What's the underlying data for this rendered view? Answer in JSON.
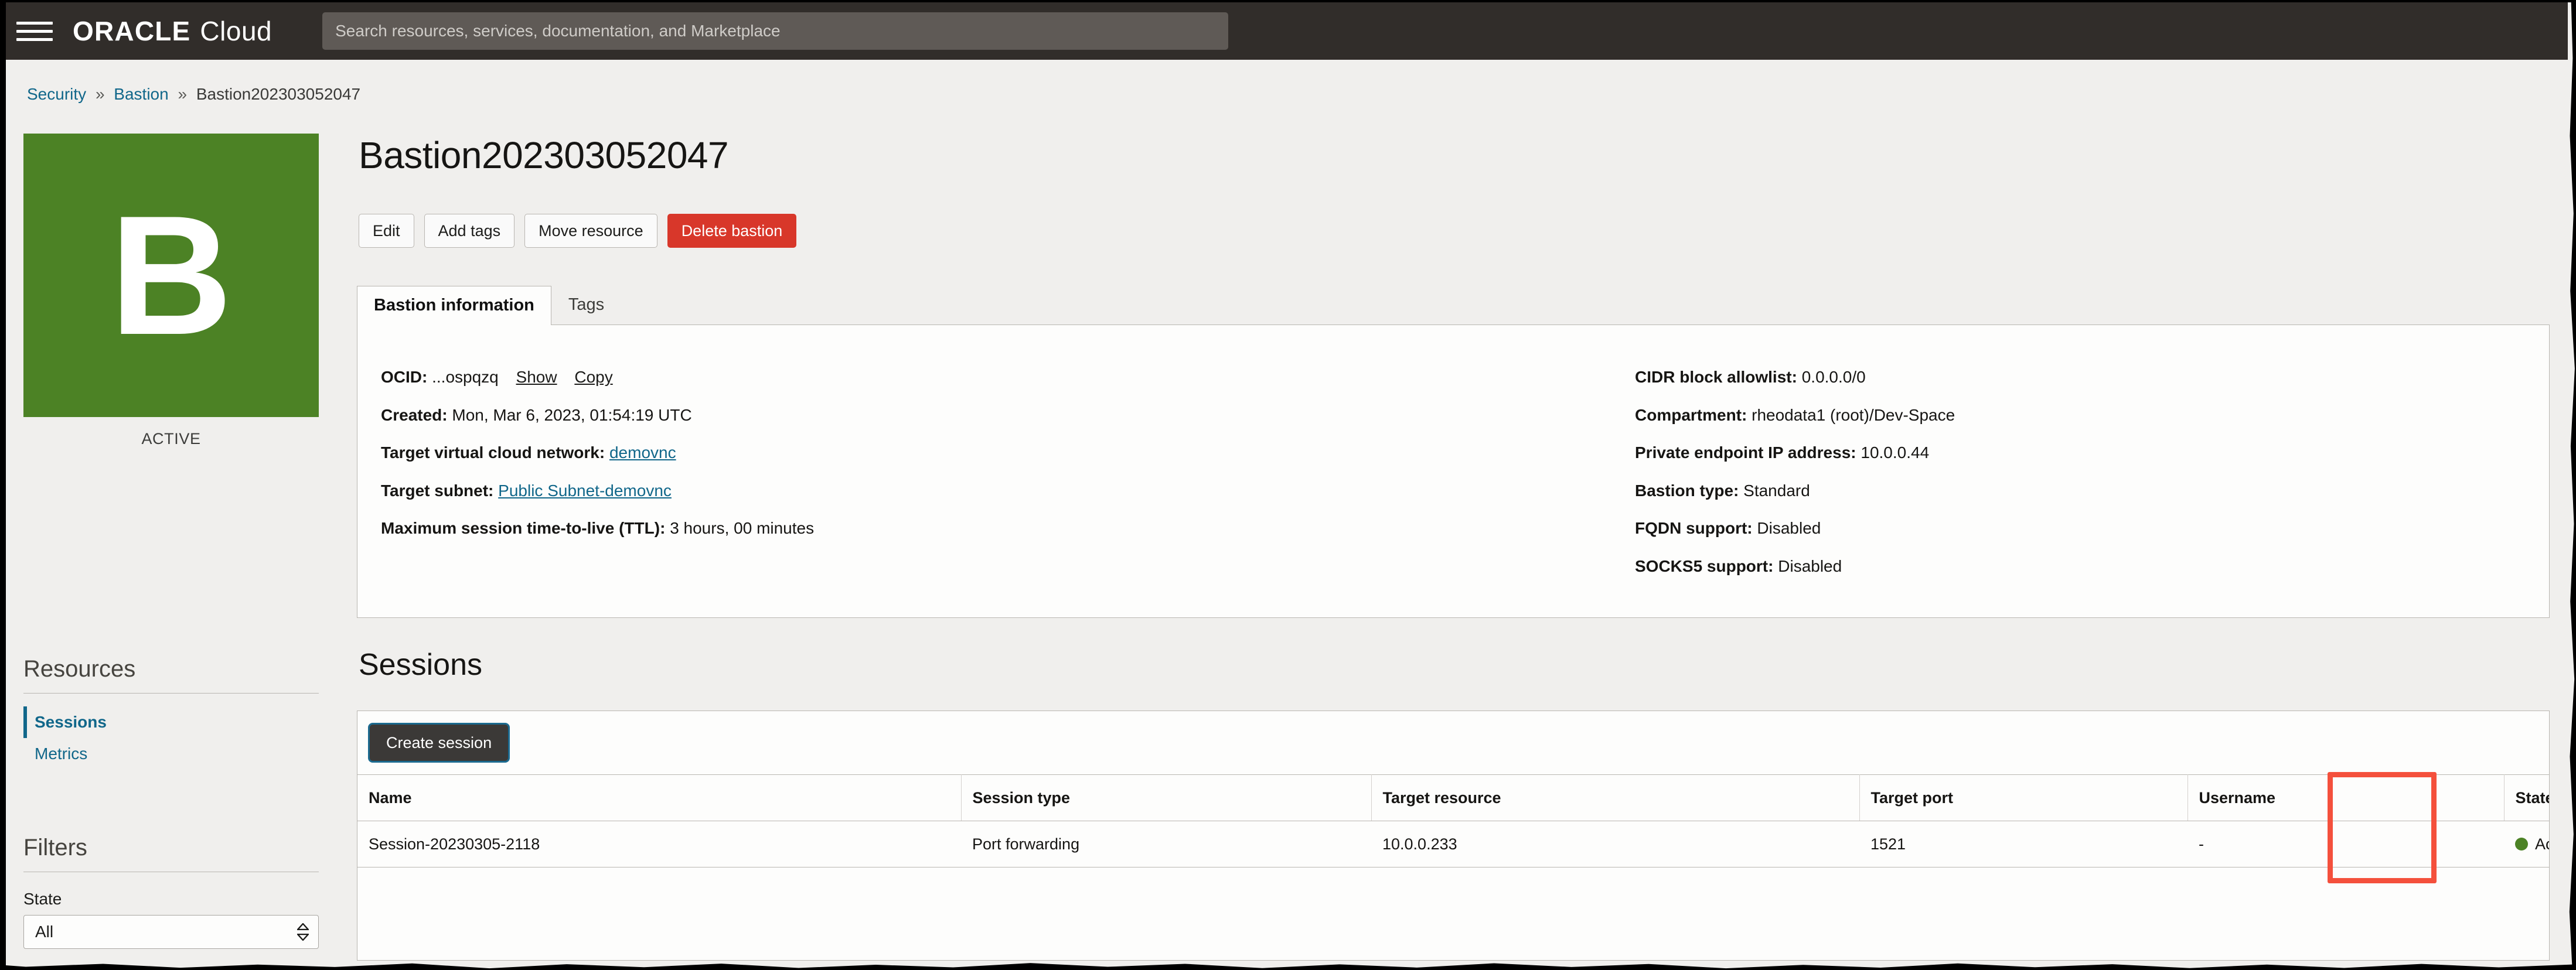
{
  "topnav": {
    "menu_icon": "hamburger-icon",
    "brand_primary": "ORACLE",
    "brand_secondary": "Cloud",
    "search_placeholder": "Search resources, services, documentation, and Marketplace",
    "search_value": ""
  },
  "breadcrumb": {
    "items": [
      {
        "label": "Security",
        "link": true
      },
      {
        "label": "Bastion",
        "link": true
      },
      {
        "label": "Bastion202303052047",
        "link": false
      }
    ],
    "separator": "»"
  },
  "avatar": {
    "letter": "B",
    "status": "ACTIVE",
    "color": "#4c8225"
  },
  "header": {
    "title": "Bastion202303052047",
    "actions": [
      {
        "label": "Edit",
        "style": "default"
      },
      {
        "label": "Add tags",
        "style": "default"
      },
      {
        "label": "Move resource",
        "style": "default"
      },
      {
        "label": "Delete bastion",
        "style": "danger"
      }
    ],
    "danger_color": "#d8372a"
  },
  "tabs": [
    {
      "label": "Bastion information",
      "active": true
    },
    {
      "label": "Tags",
      "active": false
    }
  ],
  "info": {
    "left": [
      {
        "label": "OCID:",
        "value": "...ospqzq",
        "links": [
          "Show",
          "Copy"
        ]
      },
      {
        "label": "Created:",
        "value": "Mon, Mar 6, 2023, 01:54:19 UTC"
      },
      {
        "label": "Target virtual cloud network:",
        "value": "demovnc",
        "value_is_link": true
      },
      {
        "label": "Target subnet:",
        "value": "Public Subnet-demovnc",
        "value_is_link": true
      },
      {
        "label": "Maximum session time-to-live (TTL):",
        "value": "3 hours, 00 minutes"
      }
    ],
    "right": [
      {
        "label": "CIDR block allowlist:",
        "value": "0.0.0.0/0"
      },
      {
        "label": "Compartment:",
        "value": "rheodata1 (root)/Dev-Space"
      },
      {
        "label": "Private endpoint IP address:",
        "value": "10.0.0.44"
      },
      {
        "label": "Bastion type:",
        "value": "Standard"
      },
      {
        "label": "FQDN support:",
        "value": "Disabled"
      },
      {
        "label": "SOCKS5 support:",
        "value": "Disabled"
      }
    ]
  },
  "sessions": {
    "title": "Sessions",
    "create_label": "Create session",
    "columns": [
      "Name",
      "Session type",
      "Target resource",
      "Target port",
      "Username",
      "State"
    ],
    "rows": [
      {
        "name": "Session-20230305-2118",
        "session_type": "Port forwarding",
        "target_resource": "10.0.0.233",
        "target_port": "1521",
        "username": "-",
        "state": "Active",
        "state_color": "#4c8225"
      }
    ],
    "highlight_color": "#f4503c"
  },
  "sidebar": {
    "resources_heading": "Resources",
    "resources": [
      {
        "label": "Sessions",
        "active": true
      },
      {
        "label": "Metrics",
        "active": false
      }
    ],
    "filters_heading": "Filters",
    "state_filter": {
      "label": "State",
      "value": "All"
    }
  }
}
